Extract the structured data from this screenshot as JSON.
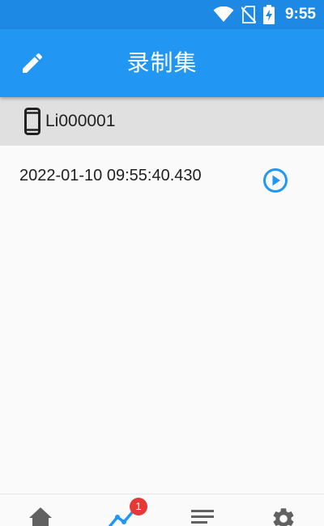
{
  "status_bar": {
    "time": "9:55",
    "icons": [
      "wifi-icon",
      "no-sim-icon",
      "battery-charging-icon"
    ]
  },
  "app_bar": {
    "title": "录制集",
    "left_icon": "pencil-icon"
  },
  "device": {
    "icon": "phone-icon",
    "label": "Li000001"
  },
  "recordings": [
    {
      "timestamp": "2022-01-10 09:55:40.430",
      "action_icon": "play-circle-icon"
    }
  ],
  "bottom_nav": {
    "items": [
      {
        "icon": "home-icon"
      },
      {
        "icon": "trend-line-icon",
        "badge": "1",
        "active": true
      },
      {
        "icon": "list-icon"
      },
      {
        "icon": "gear-icon"
      }
    ]
  },
  "colors": {
    "status_bar": "#1e88e5",
    "app_bar": "#2196f3",
    "device_header": "#e0e0e0",
    "accent": "#2196f3",
    "badge": "#e53935",
    "inactive_icon": "#616161"
  }
}
